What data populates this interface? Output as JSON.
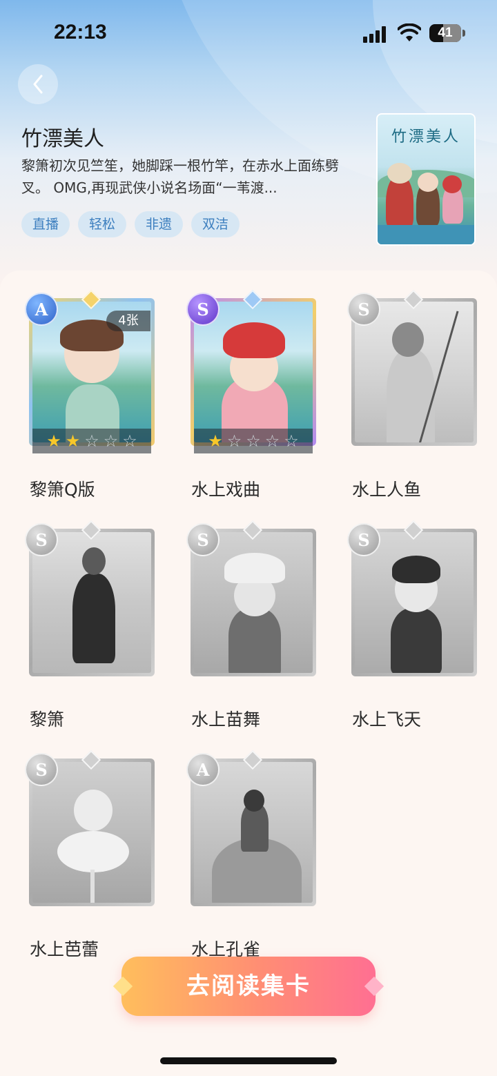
{
  "status_bar": {
    "time": "22:13",
    "battery": "41"
  },
  "header": {
    "title": "竹漂美人",
    "description": "黎箫初次见竺笙，她脚踩一根竹竿，在赤水上面练劈叉。 OMG,再现武侠小说名场面“一苇渡...",
    "tags": [
      "直播",
      "轻松",
      "非遗",
      "双洁"
    ],
    "cover_title": "竹漂美人"
  },
  "cards": [
    {
      "name": "黎箫Q版",
      "rank": "A",
      "owned": true,
      "count": "4张",
      "stars": 2,
      "max_stars": 5
    },
    {
      "name": "水上戏曲",
      "rank": "S",
      "owned": true,
      "stars": 1,
      "max_stars": 5
    },
    {
      "name": "水上人鱼",
      "rank": "S",
      "owned": false
    },
    {
      "name": "黎箫",
      "rank": "S",
      "owned": false
    },
    {
      "name": "水上苗舞",
      "rank": "S",
      "owned": false
    },
    {
      "name": "水上飞天",
      "rank": "S",
      "owned": false
    },
    {
      "name": "水上芭蕾",
      "rank": "S",
      "owned": false
    },
    {
      "name": "水上孔雀",
      "rank": "A",
      "owned": false
    }
  ],
  "action": {
    "read_button": "去阅读集卡"
  },
  "colors": {
    "tag_bg": "#d7e7f4",
    "tag_text": "#3d7fbf",
    "rank_a": "#3f7fe0",
    "rank_s_owned": "#7a4fe0",
    "locked": "#b5b5b5",
    "star_on": "#f7c72a",
    "button_gradient": [
      "#ffbe5c",
      "#ff6f92"
    ]
  },
  "icons": [
    "back-chevron-icon",
    "signal-icon",
    "wifi-icon",
    "battery-icon",
    "star-icon",
    "diamond-gem-icon"
  ]
}
